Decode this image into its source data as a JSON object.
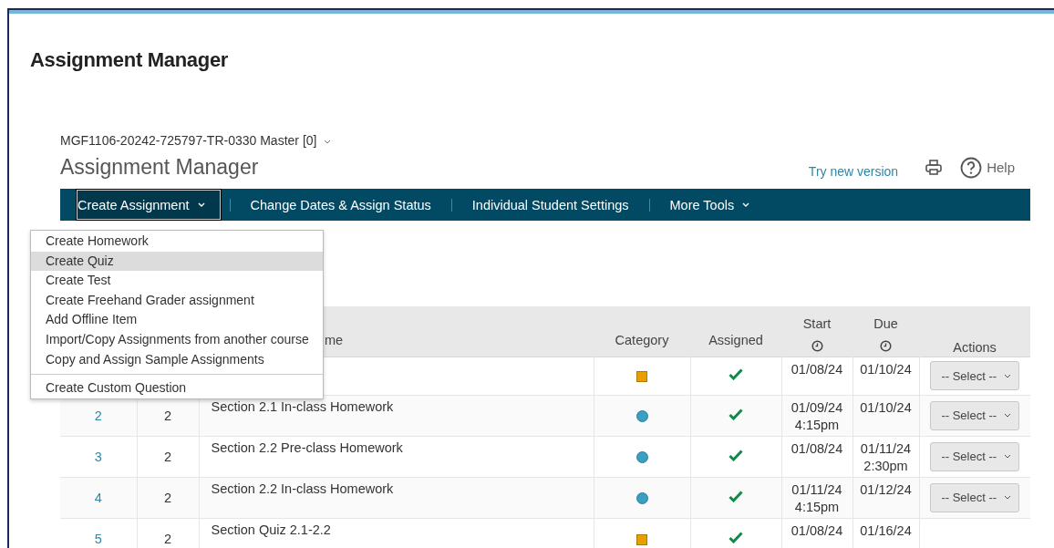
{
  "page_title": "Assignment Manager",
  "course_selector": "MGF1106-20242-725797-TR-0330 Master [0]",
  "heading": "Assignment Manager",
  "try_new_version": "Try new version",
  "help": "Help",
  "nav": [
    {
      "label": "Create Assignment",
      "kind": "menu",
      "expanded": true
    },
    {
      "label": "Change Dates & Assign Status",
      "kind": "link",
      "expanded": false
    },
    {
      "label": "Individual Student Settings",
      "kind": "link",
      "expanded": false
    },
    {
      "label": "More Tools",
      "kind": "menu",
      "expanded": false
    }
  ],
  "menu": {
    "groups": [
      [
        {
          "label": "Create Homework",
          "selected": false
        },
        {
          "label": "Create Quiz",
          "selected": true
        },
        {
          "label": "Create Test",
          "selected": false
        },
        {
          "label": "Create Freehand Grader assignment",
          "selected": false
        },
        {
          "label": "Add Offline Item",
          "selected": false
        },
        {
          "label": "Import/Copy Assignments from another course",
          "selected": false
        },
        {
          "label": "Copy and Assign Sample Assignments",
          "selected": false
        }
      ],
      [
        {
          "label": "Create Custom Question",
          "selected": false
        }
      ]
    ]
  },
  "table": {
    "columns": {
      "name_partial": "me",
      "category": "Category",
      "assigned": "Assigned",
      "start": "Start",
      "due": "Due",
      "actions": "Actions"
    },
    "rows": [
      {
        "category": {
          "kind": "square",
          "color": "#e8a000"
        },
        "assigned": true,
        "start": [
          "01/08/24"
        ],
        "due": [
          "01/10/24"
        ],
        "action": "-- Select --"
      },
      {
        "number": "2",
        "chapter": "2",
        "name": "Section 2.1 In-class Homework",
        "category": {
          "kind": "circle",
          "color": "#3a9fc0"
        },
        "assigned": true,
        "start": [
          "01/09/24",
          "4:15pm"
        ],
        "due": [
          "01/10/24"
        ],
        "action": "-- Select --"
      },
      {
        "number": "3",
        "chapter": "2",
        "name": "Section 2.2 Pre-class Homework",
        "category": {
          "kind": "circle",
          "color": "#3a9fc0"
        },
        "assigned": true,
        "start": [
          "01/08/24"
        ],
        "due": [
          "01/11/24",
          "2:30pm"
        ],
        "action": "-- Select --"
      },
      {
        "number": "4",
        "chapter": "2",
        "name": "Section 2.2 In-class Homework",
        "category": {
          "kind": "circle",
          "color": "#3a9fc0"
        },
        "assigned": true,
        "start": [
          "01/11/24",
          "4:15pm"
        ],
        "due": [
          "01/12/24"
        ],
        "action": "-- Select --"
      },
      {
        "number": "5",
        "chapter": "2",
        "name": "Section Quiz 2.1-2.2",
        "category": {
          "kind": "square",
          "color": "#e8a000"
        },
        "assigned": true,
        "start": [
          "01/08/24"
        ],
        "due": [
          "01/16/24"
        ]
      }
    ]
  }
}
